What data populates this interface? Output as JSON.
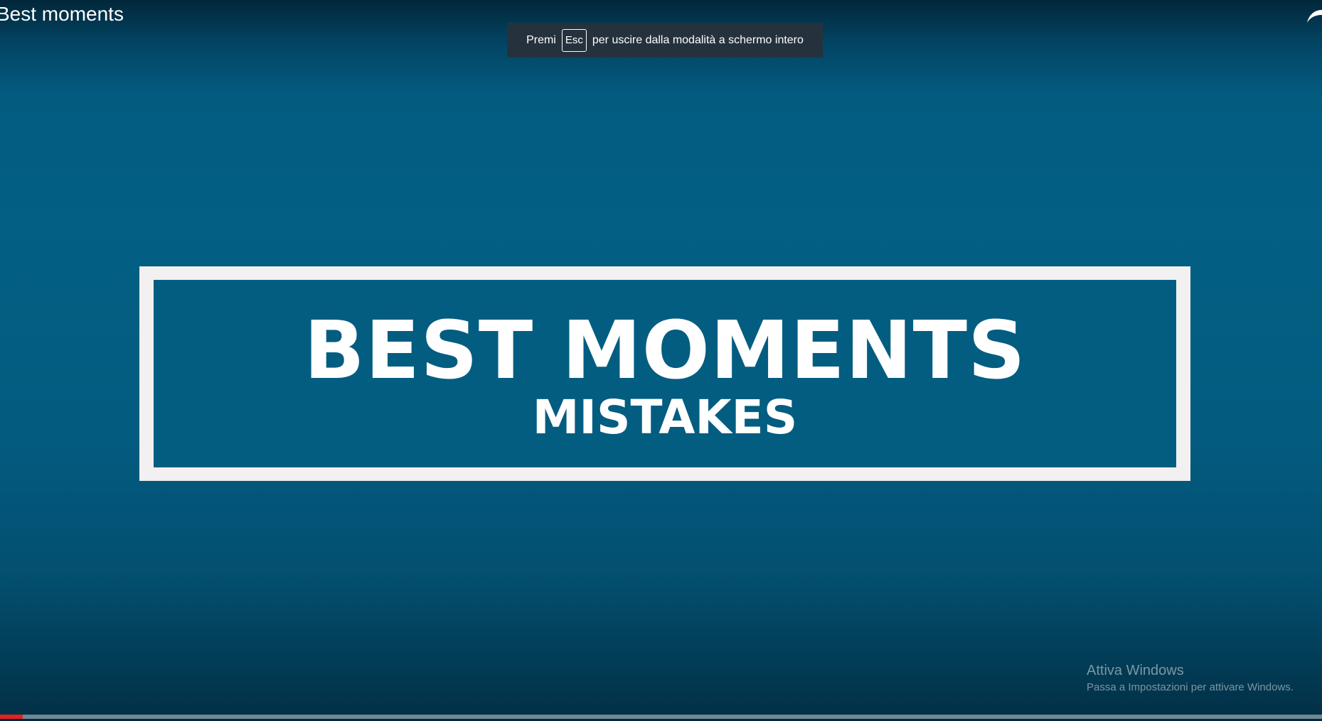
{
  "video": {
    "title": "Best moments",
    "frame": {
      "headline": "BEST MOMENTS",
      "subline": "MISTAKES"
    },
    "progress_fraction": 0.017
  },
  "fullscreen_toast": {
    "prefix": "Premi",
    "key": "Esc",
    "suffix": "per uscire dalla modalità a schermo intero"
  },
  "watermark": {
    "title": "Attiva Windows",
    "subtitle": "Passa a Impostazioni per attivare Windows."
  },
  "colors": {
    "background": "#035f84",
    "frame_border": "#f2f0f0",
    "toast_bg": "#25323e",
    "progress_played": "#e52222"
  },
  "icons": {
    "corner": "swoosh-icon"
  }
}
